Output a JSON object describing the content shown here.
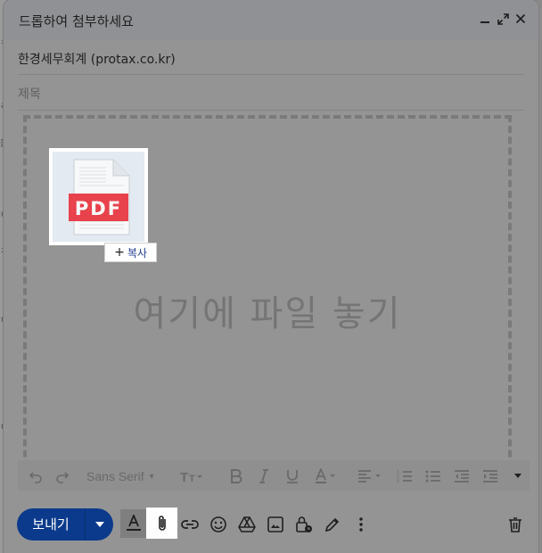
{
  "window": {
    "title": "드롭하여 첨부하세요"
  },
  "background_edge": {
    "chars": [
      "ㅋ",
      "ㄹ",
      "을",
      "ㄷ",
      "ㅊ",
      "ㅁ",
      "ㄷ"
    ]
  },
  "fields": {
    "to_value": "한경세무회계 (protax.co.kr)",
    "subject_placeholder": "제목"
  },
  "dropzone": {
    "hint": "여기에 파일 놓기"
  },
  "dragged_file": {
    "type_label": "PDF",
    "copy_badge_label": "복사",
    "pdf_color": "#e8424d"
  },
  "formatting": {
    "font_name": "Sans Serif"
  },
  "footer": {
    "send_label": "보내기"
  },
  "colors": {
    "send": "#0b3a8c",
    "highlight": "#ffffff"
  }
}
